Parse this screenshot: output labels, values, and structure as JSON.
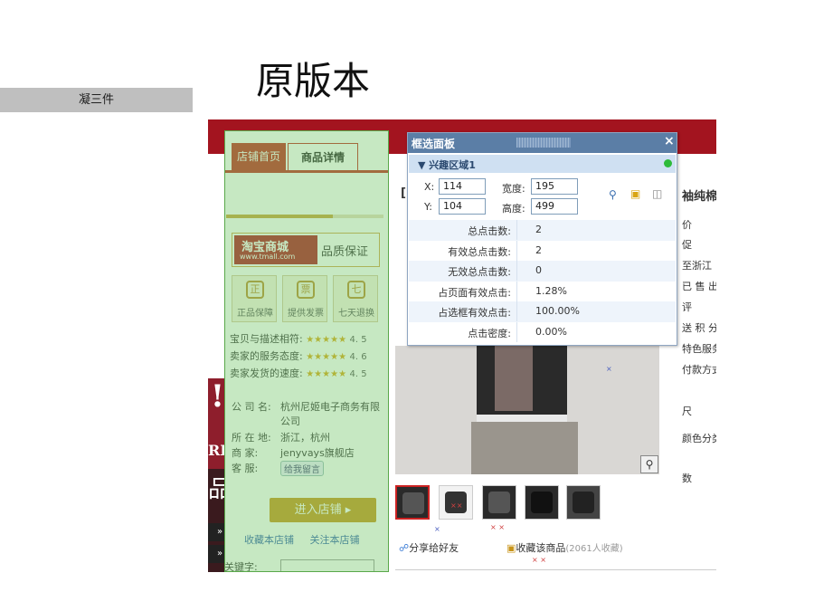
{
  "slide": {
    "title": "原版本",
    "side_tag": "凝三件"
  },
  "topbar_color": "#a3141f",
  "shop": {
    "tabs": {
      "home": "店铺首页",
      "detail": "商品详情"
    },
    "progress_fraction": 0.68,
    "tmall": {
      "logo_line1": "淘宝商城",
      "logo_line2": "www.tmall.com",
      "quality": "品质保证"
    },
    "badges": [
      {
        "icon": "正",
        "label": "正品保障"
      },
      {
        "icon": "票",
        "label": "提供发票"
      },
      {
        "icon": "七",
        "label": "七天退换"
      }
    ],
    "ratings": [
      {
        "label": "宝贝与描述相符:",
        "stars": "★★★★★",
        "score": "4. 5"
      },
      {
        "label": "卖家的服务态度:",
        "stars": "★★★★★",
        "score": "4. 6"
      },
      {
        "label": "卖家发货的速度:",
        "stars": "★★★★★",
        "score": "4. 5"
      }
    ],
    "info": {
      "company_label": "公 司 名:",
      "company_value": "杭州尼姬电子商务有限公司",
      "location_label": "所 在 地:",
      "location_value": "浙江，杭州",
      "merchant_label": "商    家:",
      "merchant_value": "jenyvays旗舰店",
      "service_label": "客    服:",
      "service_value": "给我留言"
    },
    "enter_shop": "进入店铺 ▸",
    "links": {
      "collect": "收藏本店铺",
      "follow": "关注本店铺"
    },
    "keyword_label": "关键字:"
  },
  "left_strip": {
    "big_char": "!",
    "rk": "RK",
    "pin": "品",
    "arrows": [
      "»",
      "»"
    ]
  },
  "panel": {
    "title": "框选面板",
    "close": "×",
    "region": "▼ 兴趣区域1",
    "x_label": "X:",
    "x_value": "114",
    "y_label": "Y:",
    "y_value": "104",
    "width_label": "宽度:",
    "width_value": "195",
    "height_label": "高度:",
    "height_value": "499",
    "stats": [
      {
        "label": "总点击数:",
        "value": "2"
      },
      {
        "label": "有效总点击数:",
        "value": "2"
      },
      {
        "label": "无效总点击数:",
        "value": "0"
      },
      {
        "label": "占页面有效点击:",
        "value": "1.28%"
      },
      {
        "label": "占选框有效点击:",
        "value": "100.00%"
      },
      {
        "label": "点击密度:",
        "value": "0.00%"
      }
    ]
  },
  "product": {
    "share": "分享给好友",
    "favorite": "收藏该商品",
    "favorite_count": "(2061人收藏)",
    "bracket": "[",
    "right_texts": [
      "袖纯棉",
      "价",
      "促",
      "至浙江",
      "已 售 出",
      "评",
      "送 积 分",
      "特色服务",
      "付款方式",
      "尺",
      "颜色分类",
      "数"
    ]
  }
}
